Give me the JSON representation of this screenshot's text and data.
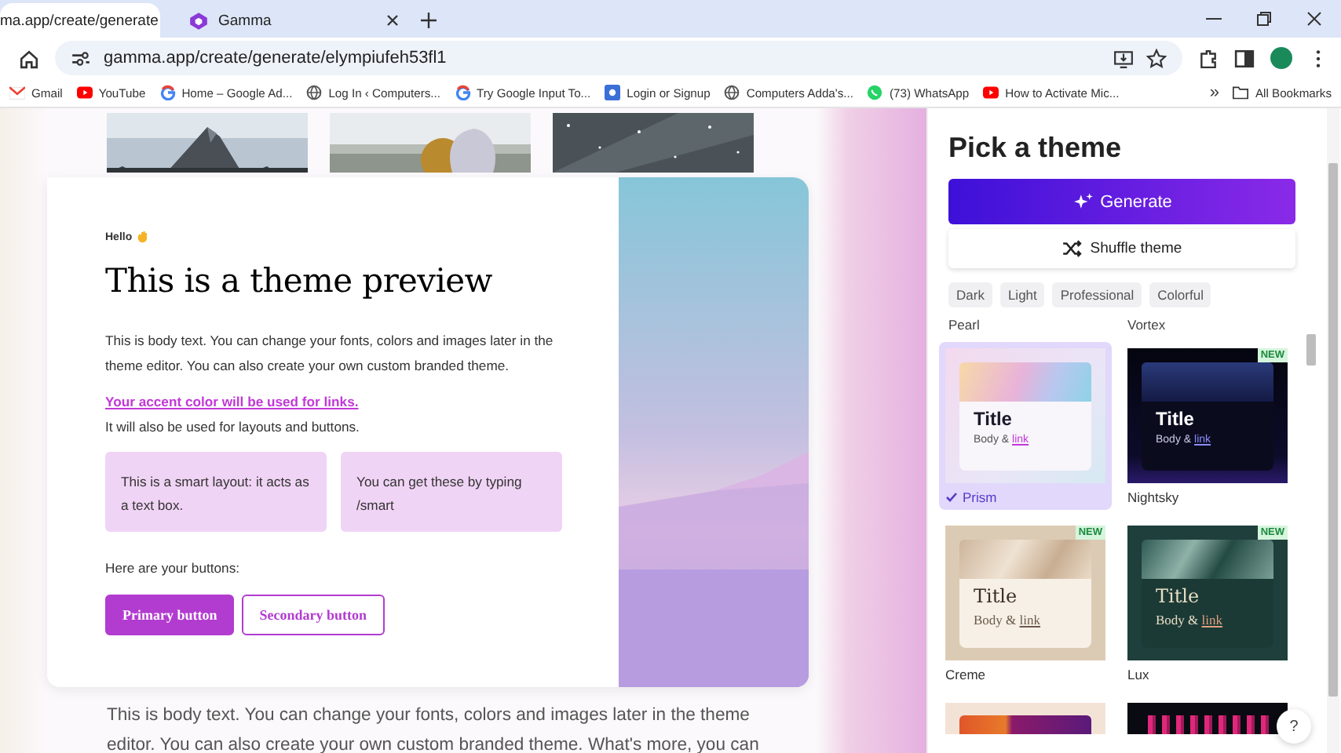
{
  "browser": {
    "tabs": [
      {
        "title": "ma.app/create/generate",
        "selected": true
      },
      {
        "title": "Gamma",
        "selected": false
      }
    ],
    "url": "gamma.app/create/generate/elympiufeh53fl1",
    "bookmarks": [
      {
        "label": "Gmail",
        "kind": "mail"
      },
      {
        "label": "YouTube",
        "kind": "play"
      },
      {
        "label": "Home – Google Ad...",
        "kind": "g"
      },
      {
        "label": "Log In ‹ Computers...",
        "kind": "globe"
      },
      {
        "label": "Try Google Input To...",
        "kind": "g"
      },
      {
        "label": "Login or Signup",
        "kind": "square"
      },
      {
        "label": "Computers Adda's...",
        "kind": "globe"
      },
      {
        "label": "(73) WhatsApp",
        "kind": "chat"
      },
      {
        "label": "How to Activate Mic...",
        "kind": "play"
      }
    ],
    "more": "»",
    "all_bookmarks": "All Bookmarks"
  },
  "preview": {
    "greeting": "Hello",
    "heading": "This is a theme preview",
    "body": "This is body text. You can change your fonts, colors and images later in the theme editor. You can also create your own custom branded theme.",
    "link": "Your accent color will be used for links.",
    "note": "It will also be used for layouts and buttons.",
    "smart_boxes": [
      "This is a smart layout: it acts as a text box.",
      "You can get these by typing /smart"
    ],
    "buttons_label": "Here are your buttons:",
    "buttons": [
      {
        "label": "Primary button",
        "kind": "primary"
      },
      {
        "label": "Secondary button",
        "kind": "secondary"
      }
    ],
    "below_text": [
      "This is body text. You can change your fonts, colors and images later in the theme",
      "editor. You can also create your own custom branded theme. What's more, you can"
    ]
  },
  "theme_panel": {
    "title": "Pick a theme",
    "generate": "Generate",
    "shuffle": "Shuffle theme",
    "filters": [
      {
        "label": "Dark"
      },
      {
        "label": "Light"
      },
      {
        "label": "Professional"
      },
      {
        "label": "Colorful"
      }
    ],
    "scrolled_names": [
      "Pearl",
      "Vortex"
    ],
    "themes": [
      {
        "kind": "card",
        "name": "Prism",
        "title": "Title",
        "body": "Body &",
        "link": "link",
        "selected": true
      },
      {
        "kind": "card",
        "name": "Nightsky",
        "title": "Title",
        "body": "Body &",
        "link": "link",
        "badge": "NEW",
        "selected": false
      },
      {
        "kind": "card",
        "name": "Creme",
        "title": "Title",
        "body": "Body &",
        "link": "link",
        "badge": "NEW",
        "selected": false
      },
      {
        "kind": "card",
        "name": "Lux",
        "title": "Title",
        "body": "Body &",
        "link": "link",
        "badge": "NEW",
        "selected": false
      },
      {
        "kind": "partial"
      },
      {
        "kind": "partial"
      }
    ],
    "help": "?"
  }
}
